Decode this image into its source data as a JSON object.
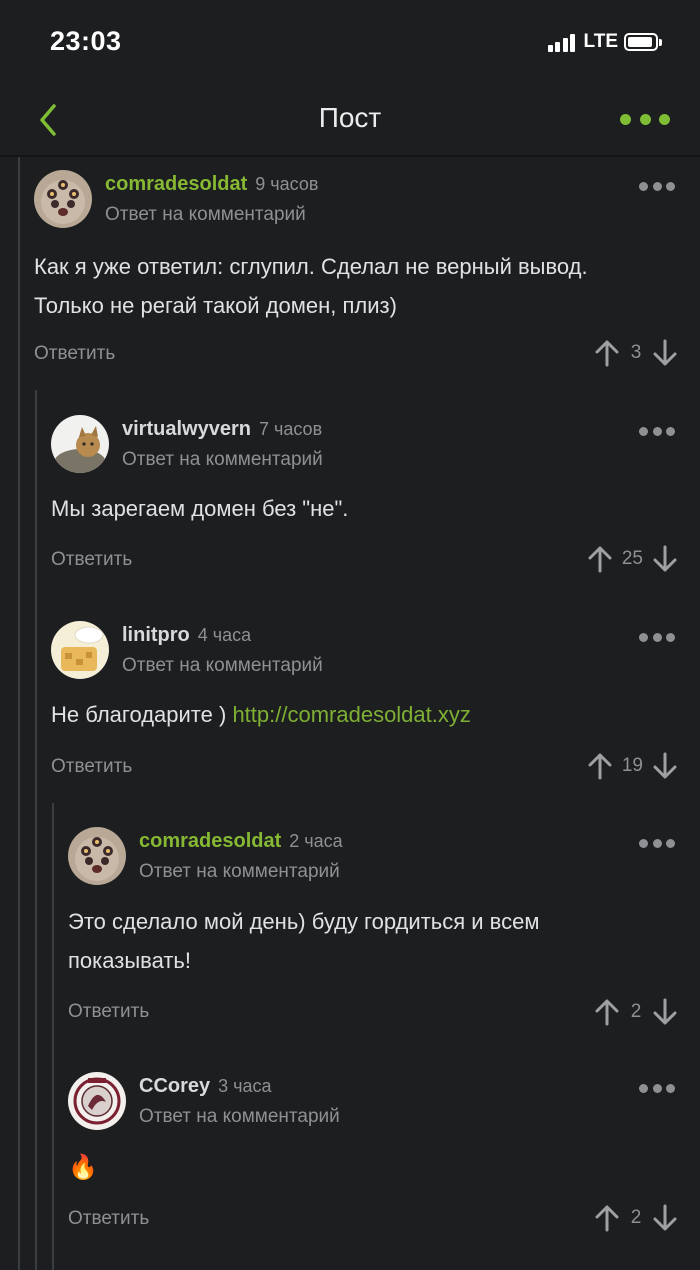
{
  "status_bar": {
    "time": "23:03",
    "network": "LTE"
  },
  "nav": {
    "title": "Пост"
  },
  "comments": [
    {
      "username": "comradesoldat",
      "time": "9 часов",
      "reply_note": "Ответ на комментарий",
      "text_lines": [
        "Как я уже ответил: сглупил. Сделал не верный вывод.",
        "Только не регай такой домен, плиз)"
      ],
      "reply_label": "Ответить",
      "votes": "3"
    },
    {
      "username": "virtualwyvern",
      "time": "7 часов",
      "reply_note": "Ответ на комментарий",
      "text_lines": [
        "Мы зарегаем домен без \"не\"."
      ],
      "reply_label": "Ответить",
      "votes": "25"
    },
    {
      "username": "linitpro",
      "time": "4 часа",
      "reply_note": "Ответ на комментарий",
      "text_prefix": "Не благодарите ) ",
      "link": "http://comradesoldat.xyz",
      "reply_label": "Ответить",
      "votes": "19"
    },
    {
      "username": "comradesoldat",
      "time": "2 часа",
      "reply_note": "Ответ на комментарий",
      "text_lines": [
        "Это сделало мой день) буду гордиться и всем",
        "показывать!"
      ],
      "reply_label": "Ответить",
      "votes": "2"
    },
    {
      "username": "CCorey",
      "time": "3 часа",
      "reply_note": "Ответ на комментарий",
      "text_lines": [
        "🔥"
      ],
      "reply_label": "Ответить",
      "votes": "2"
    }
  ],
  "icons": {
    "back": "chevron-left-icon",
    "more": "more-horizontal-icon",
    "upvote": "arrow-up-icon",
    "downvote": "arrow-down-icon"
  },
  "colors": {
    "background": "#1c1e20",
    "accent": "#7fbd34",
    "op_username": "#86b833",
    "muted": "#8e9194"
  }
}
